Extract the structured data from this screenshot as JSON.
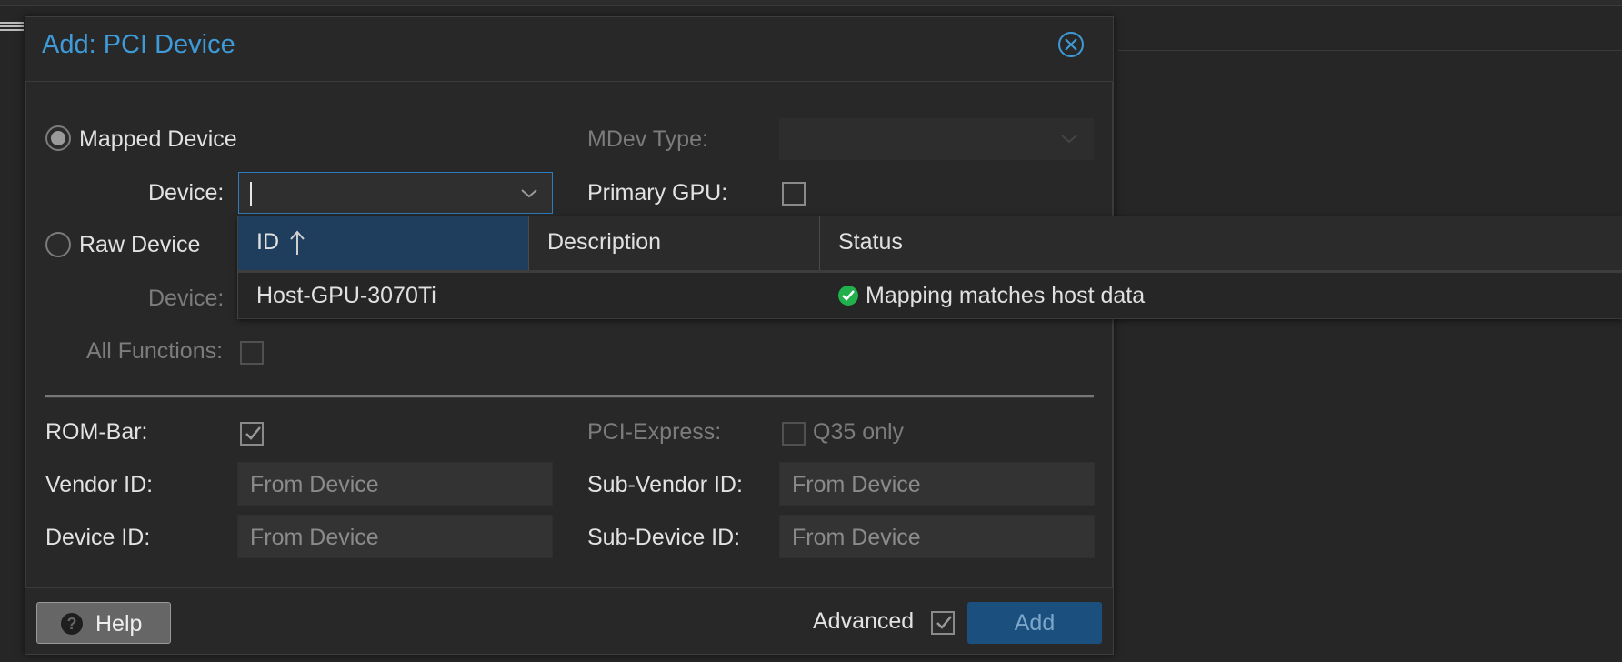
{
  "dialog": {
    "title": "Add: PCI Device"
  },
  "form": {
    "mapped_device_label": "Mapped Device",
    "device_label": "Device:",
    "device_value": "",
    "raw_device_label": "Raw Device",
    "raw_device_label2": "Device:",
    "all_functions_label": "All Functions:",
    "mdev_type_label": "MDev Type:",
    "primary_gpu_label": "Primary GPU:",
    "rom_bar_label": "ROM-Bar:",
    "pci_express_label": "PCI-Express:",
    "q35_only_label": "Q35 only",
    "vendor_id_label": "Vendor ID:",
    "vendor_id_placeholder": "From Device",
    "sub_vendor_id_label": "Sub-Vendor ID:",
    "sub_vendor_id_placeholder": "From Device",
    "device_id_label": "Device ID:",
    "device_id_placeholder": "From Device",
    "sub_device_id_label": "Sub-Device ID:",
    "sub_device_id_placeholder": "From Device",
    "mapped_selected": true,
    "rom_bar_checked": true,
    "primary_gpu_checked": false
  },
  "dropdown": {
    "columns": [
      {
        "label": "ID",
        "sort": "asc"
      },
      {
        "label": "Description"
      },
      {
        "label": "Status"
      }
    ],
    "rows": [
      {
        "id": "Host-GPU-3070Ti",
        "description": "",
        "status": "Mapping matches host data",
        "status_icon": "check-circle-icon"
      }
    ]
  },
  "footer": {
    "help_label": "Help",
    "advanced_label": "Advanced",
    "advanced_checked": true,
    "add_label": "Add"
  },
  "colors": {
    "accent": "#3e9bd8",
    "status_ok": "#21b04b",
    "primary_button": "#1b4f7e"
  }
}
